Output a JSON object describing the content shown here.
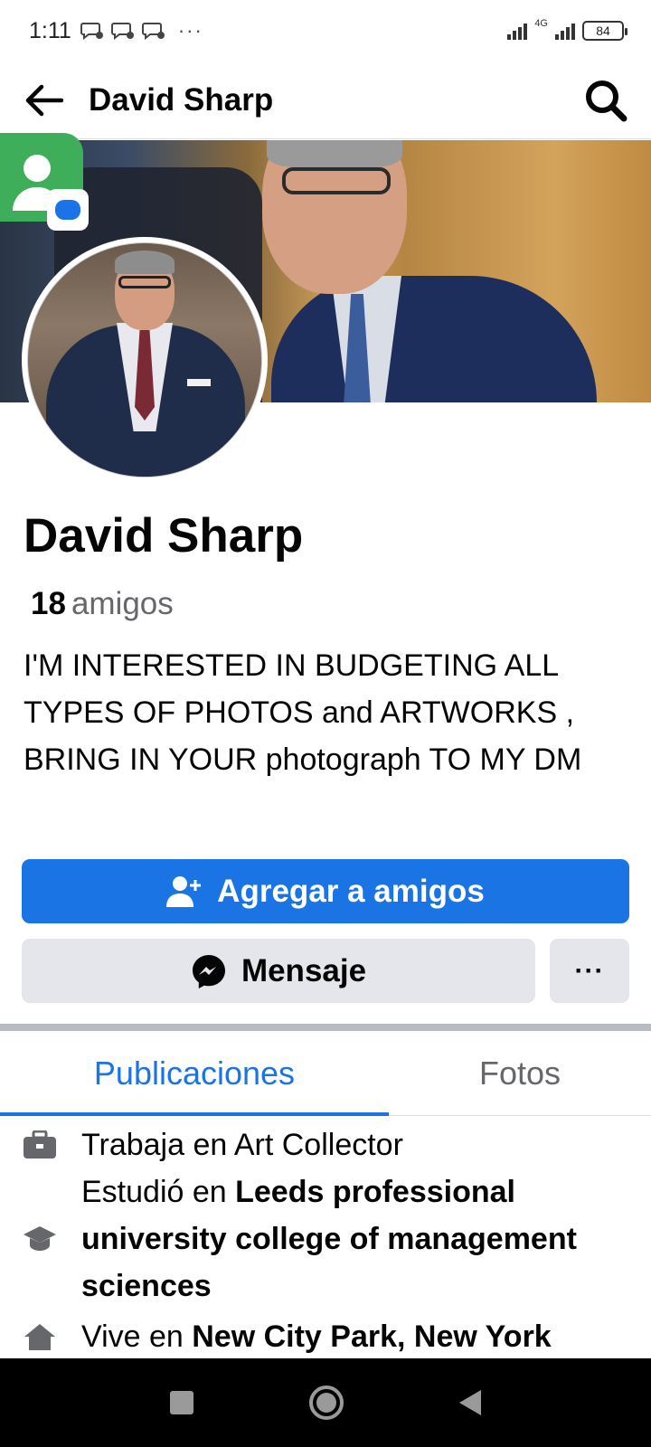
{
  "status_bar": {
    "time": "1:11",
    "more": "···",
    "network": "4G",
    "battery": "84"
  },
  "app_bar": {
    "title": "David Sharp"
  },
  "profile": {
    "name": "David Sharp",
    "friends_count": "18",
    "friends_label": "amigos",
    "bio": "I'M INTERESTED IN BUDGETING ALL TYPES OF PHOTOS and ARTWORKS , BRING IN YOUR photograph TO MY DM"
  },
  "actions": {
    "add_friend": "Agregar a amigos",
    "message": "Mensaje",
    "more": "···"
  },
  "tabs": [
    {
      "label": "Publicaciones",
      "active": true
    },
    {
      "label": "Fotos",
      "active": false
    }
  ],
  "details": {
    "work_prefix": "Trabaja en ",
    "work_place": "Art Collector",
    "study_prefix": "Estudió en ",
    "study_place": "Leeds professional university college of management sciences",
    "lives_prefix": "Vive en ",
    "lives_place": "New City Park, New York"
  },
  "colors": {
    "accent": "#1b74e4",
    "secondary_button": "#e4e6eb",
    "muted_text": "#65676b"
  }
}
